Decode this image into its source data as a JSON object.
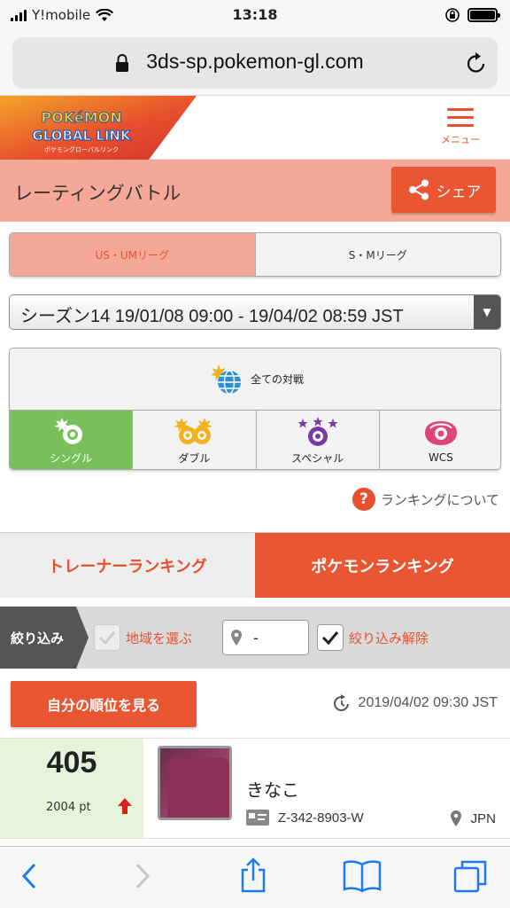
{
  "status_bar": {
    "carrier": "Y!mobile",
    "time": "13:18"
  },
  "browser": {
    "url": "3ds-sp.pokemon-gl.com"
  },
  "header": {
    "logo_line1": "POKéMON",
    "logo_line2": "GLOBAL LINK",
    "logo_line3": "ポケモングローバルリンク",
    "menu_label": "メニュー"
  },
  "page": {
    "title": "レーティングバトル",
    "share_label": "シェア"
  },
  "league_tabs": [
    {
      "label": "US・UMリーグ"
    },
    {
      "label": "S・Mリーグ"
    }
  ],
  "season": {
    "selected": "シーズン14 19/01/08 09:00 - 19/04/02 08:59 JST"
  },
  "battle_types": {
    "all_label": "全ての対戦",
    "items": [
      {
        "label": "シングル"
      },
      {
        "label": "ダブル"
      },
      {
        "label": "スペシャル"
      },
      {
        "label": "WCS"
      }
    ]
  },
  "about_ranking": "ランキングについて",
  "ranking_tabs": {
    "trainer": "トレーナーランキング",
    "pokemon": "ポケモンランキング"
  },
  "filter": {
    "label": "絞り込み",
    "region_label": "地域を選ぶ",
    "location_value": "-",
    "clear_label": "絞り込み解除"
  },
  "my_rank_button": "自分の順位を見る",
  "updated_at": "2019/04/02 09:30 JST",
  "entry": {
    "rank": "405",
    "points": "2004 pt",
    "name": "きなこ",
    "player_id": "Z-342-8903-W",
    "country": "JPN"
  },
  "colors": {
    "accent": "#ea5532",
    "title_bg": "#f5a898",
    "selected_green": "#7ac05a"
  }
}
